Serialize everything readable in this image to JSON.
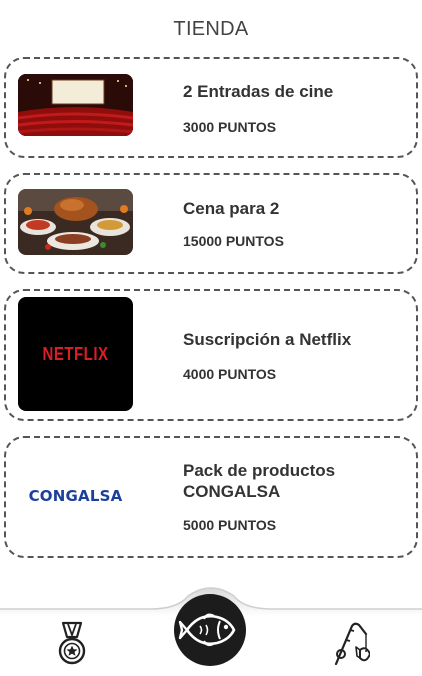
{
  "header": {
    "title": "TIENDA"
  },
  "products": [
    {
      "name": "2 Entradas de cine",
      "points": "3000 PUNTOS",
      "image": "cinema-image"
    },
    {
      "name": "Cena para 2",
      "points": "15000 PUNTOS",
      "image": "dinner-image"
    },
    {
      "name": "Suscripción a Netflix",
      "points": "4000 PUNTOS",
      "image": "netflix-logo",
      "logo_text": "NETFLIX"
    },
    {
      "name": "Pack de productos CONGALSA",
      "points": "5000 PUNTOS",
      "image": "congalsa-logo",
      "logo_text": "CONGALSA"
    }
  ],
  "nav": {
    "items": [
      {
        "icon": "medal-icon"
      },
      {
        "icon": "fish-icon",
        "active": true
      },
      {
        "icon": "fishing-rod-icon"
      }
    ]
  },
  "colors": {
    "netflix_red": "#d81f26",
    "congalsa_blue": "#1c3f9a",
    "active_nav_bg": "#1c1c1c",
    "card_border": "#555555"
  }
}
